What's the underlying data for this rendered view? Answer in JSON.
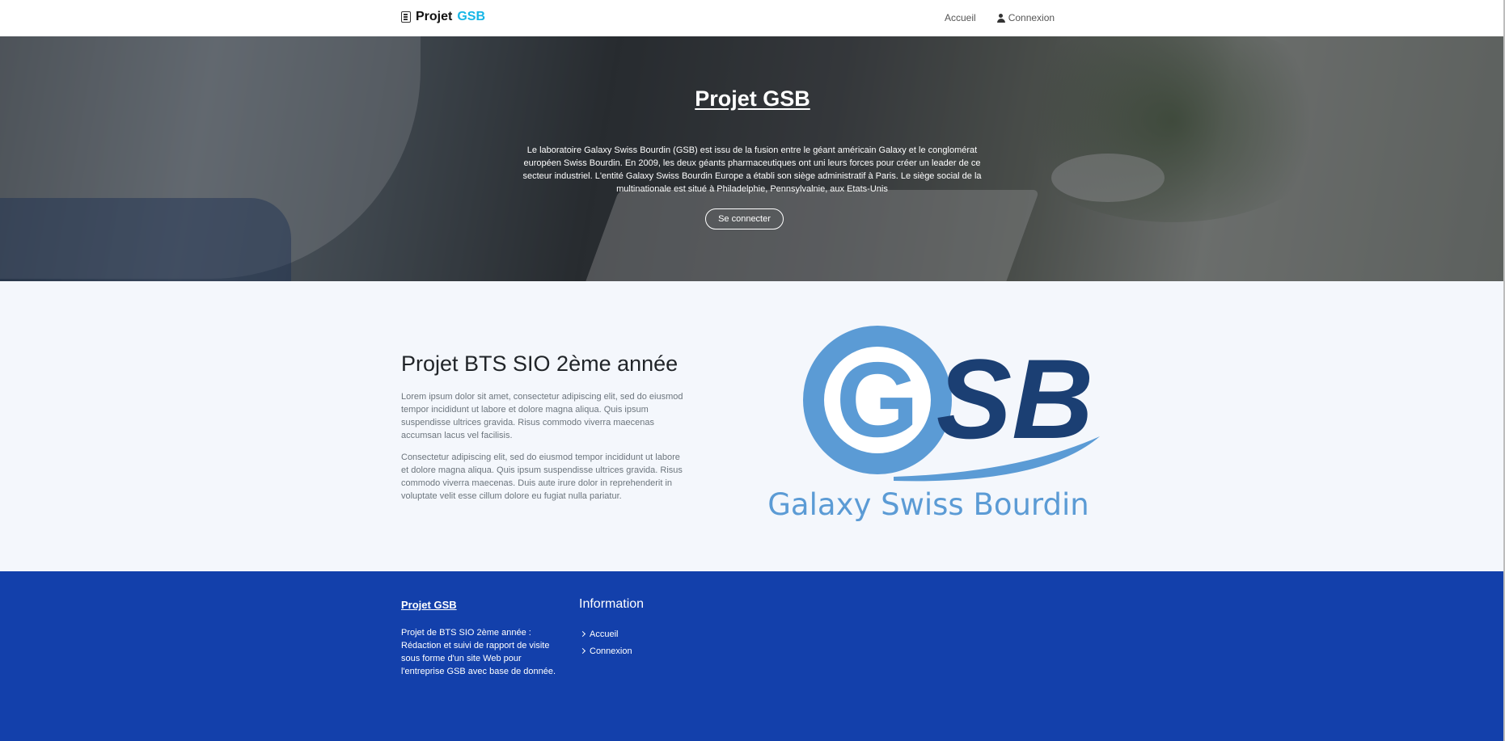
{
  "navbar": {
    "brand_prefix": "Projet",
    "brand_accent": "GSB",
    "links": [
      {
        "label": "Accueil",
        "icon": ""
      },
      {
        "label": "Connexion",
        "icon": "user-icon"
      }
    ]
  },
  "hero": {
    "title": "Projet GSB",
    "text": "Le laboratoire Galaxy Swiss Bourdin (GSB) est issu de la fusion entre le géant américain Galaxy et le conglomérat européen Swiss Bourdin. En 2009, les deux géants pharmaceutiques ont uni leurs forces pour créer un leader de ce secteur industriel. L'entité Galaxy Swiss Bourdin Europe a établi son siège administratif à Paris. Le siège social de la multinationale est situé à Philadelphie, Pennsylvalnie, aux Etats-Unis",
    "button_label": "Se connecter"
  },
  "about": {
    "title": "Projet BTS SIO 2ème année",
    "paragraph1": "Lorem ipsum dolor sit amet, consectetur adipiscing elit, sed do eiusmod tempor incididunt ut labore et dolore magna aliqua. Quis ipsum suspendisse ultrices gravida. Risus commodo viverra maecenas accumsan lacus vel facilisis.",
    "paragraph2": "Consectetur adipiscing elit, sed do eiusmod tempor incididunt ut labore et dolore magna aliqua. Quis ipsum suspendisse ultrices gravida. Risus commodo viverra maecenas. Duis aute irure dolor in reprehenderit in voluptate velit esse cillum dolore eu fugiat nulla pariatur.",
    "logo": {
      "letters": "GSB",
      "g_letter": "G",
      "sb_letters": "SB",
      "tagline": "Galaxy Swiss Bourdin"
    }
  },
  "footer": {
    "brand": "Projet GSB",
    "description": "Projet de BTS SIO 2ème année : Rédaction et suivi de rapport de visite sous forme d'un site Web pour l'entreprise GSB avec base de donnée.",
    "heading": "Information",
    "links": [
      "Accueil",
      "Connexion"
    ]
  },
  "colors": {
    "brand_accent": "#17b6e6",
    "footer_bg": "#1340ab",
    "about_bg": "#f4f7fc",
    "logo_light_blue": "#5b9bd5",
    "logo_dark_blue": "#1b3f73"
  }
}
